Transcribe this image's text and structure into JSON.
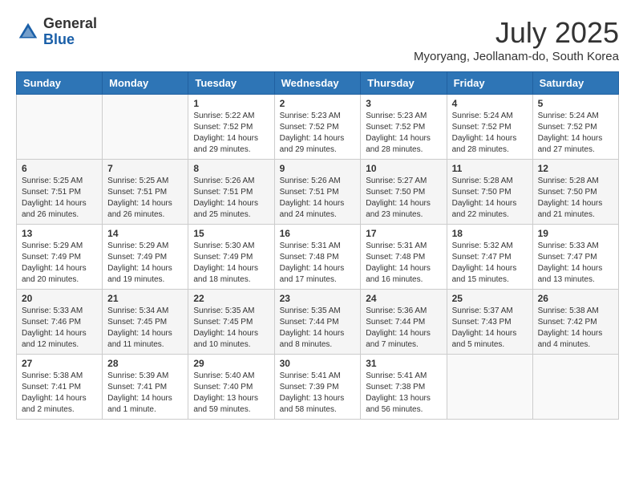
{
  "header": {
    "logo_general": "General",
    "logo_blue": "Blue",
    "month_title": "July 2025",
    "location": "Myoryang, Jeollanam-do, South Korea"
  },
  "weekdays": [
    "Sunday",
    "Monday",
    "Tuesday",
    "Wednesday",
    "Thursday",
    "Friday",
    "Saturday"
  ],
  "weeks": [
    [
      {
        "day": "",
        "info": ""
      },
      {
        "day": "",
        "info": ""
      },
      {
        "day": "1",
        "info": "Sunrise: 5:22 AM\nSunset: 7:52 PM\nDaylight: 14 hours and 29 minutes."
      },
      {
        "day": "2",
        "info": "Sunrise: 5:23 AM\nSunset: 7:52 PM\nDaylight: 14 hours and 29 minutes."
      },
      {
        "day": "3",
        "info": "Sunrise: 5:23 AM\nSunset: 7:52 PM\nDaylight: 14 hours and 28 minutes."
      },
      {
        "day": "4",
        "info": "Sunrise: 5:24 AM\nSunset: 7:52 PM\nDaylight: 14 hours and 28 minutes."
      },
      {
        "day": "5",
        "info": "Sunrise: 5:24 AM\nSunset: 7:52 PM\nDaylight: 14 hours and 27 minutes."
      }
    ],
    [
      {
        "day": "6",
        "info": "Sunrise: 5:25 AM\nSunset: 7:51 PM\nDaylight: 14 hours and 26 minutes."
      },
      {
        "day": "7",
        "info": "Sunrise: 5:25 AM\nSunset: 7:51 PM\nDaylight: 14 hours and 26 minutes."
      },
      {
        "day": "8",
        "info": "Sunrise: 5:26 AM\nSunset: 7:51 PM\nDaylight: 14 hours and 25 minutes."
      },
      {
        "day": "9",
        "info": "Sunrise: 5:26 AM\nSunset: 7:51 PM\nDaylight: 14 hours and 24 minutes."
      },
      {
        "day": "10",
        "info": "Sunrise: 5:27 AM\nSunset: 7:50 PM\nDaylight: 14 hours and 23 minutes."
      },
      {
        "day": "11",
        "info": "Sunrise: 5:28 AM\nSunset: 7:50 PM\nDaylight: 14 hours and 22 minutes."
      },
      {
        "day": "12",
        "info": "Sunrise: 5:28 AM\nSunset: 7:50 PM\nDaylight: 14 hours and 21 minutes."
      }
    ],
    [
      {
        "day": "13",
        "info": "Sunrise: 5:29 AM\nSunset: 7:49 PM\nDaylight: 14 hours and 20 minutes."
      },
      {
        "day": "14",
        "info": "Sunrise: 5:29 AM\nSunset: 7:49 PM\nDaylight: 14 hours and 19 minutes."
      },
      {
        "day": "15",
        "info": "Sunrise: 5:30 AM\nSunset: 7:49 PM\nDaylight: 14 hours and 18 minutes."
      },
      {
        "day": "16",
        "info": "Sunrise: 5:31 AM\nSunset: 7:48 PM\nDaylight: 14 hours and 17 minutes."
      },
      {
        "day": "17",
        "info": "Sunrise: 5:31 AM\nSunset: 7:48 PM\nDaylight: 14 hours and 16 minutes."
      },
      {
        "day": "18",
        "info": "Sunrise: 5:32 AM\nSunset: 7:47 PM\nDaylight: 14 hours and 15 minutes."
      },
      {
        "day": "19",
        "info": "Sunrise: 5:33 AM\nSunset: 7:47 PM\nDaylight: 14 hours and 13 minutes."
      }
    ],
    [
      {
        "day": "20",
        "info": "Sunrise: 5:33 AM\nSunset: 7:46 PM\nDaylight: 14 hours and 12 minutes."
      },
      {
        "day": "21",
        "info": "Sunrise: 5:34 AM\nSunset: 7:45 PM\nDaylight: 14 hours and 11 minutes."
      },
      {
        "day": "22",
        "info": "Sunrise: 5:35 AM\nSunset: 7:45 PM\nDaylight: 14 hours and 10 minutes."
      },
      {
        "day": "23",
        "info": "Sunrise: 5:35 AM\nSunset: 7:44 PM\nDaylight: 14 hours and 8 minutes."
      },
      {
        "day": "24",
        "info": "Sunrise: 5:36 AM\nSunset: 7:44 PM\nDaylight: 14 hours and 7 minutes."
      },
      {
        "day": "25",
        "info": "Sunrise: 5:37 AM\nSunset: 7:43 PM\nDaylight: 14 hours and 5 minutes."
      },
      {
        "day": "26",
        "info": "Sunrise: 5:38 AM\nSunset: 7:42 PM\nDaylight: 14 hours and 4 minutes."
      }
    ],
    [
      {
        "day": "27",
        "info": "Sunrise: 5:38 AM\nSunset: 7:41 PM\nDaylight: 14 hours and 2 minutes."
      },
      {
        "day": "28",
        "info": "Sunrise: 5:39 AM\nSunset: 7:41 PM\nDaylight: 14 hours and 1 minute."
      },
      {
        "day": "29",
        "info": "Sunrise: 5:40 AM\nSunset: 7:40 PM\nDaylight: 13 hours and 59 minutes."
      },
      {
        "day": "30",
        "info": "Sunrise: 5:41 AM\nSunset: 7:39 PM\nDaylight: 13 hours and 58 minutes."
      },
      {
        "day": "31",
        "info": "Sunrise: 5:41 AM\nSunset: 7:38 PM\nDaylight: 13 hours and 56 minutes."
      },
      {
        "day": "",
        "info": ""
      },
      {
        "day": "",
        "info": ""
      }
    ]
  ]
}
